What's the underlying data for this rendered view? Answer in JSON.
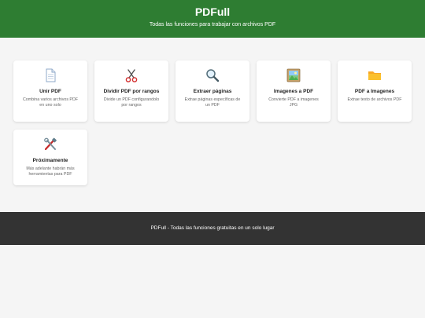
{
  "header": {
    "title": "PDFull",
    "subtitle": "Todas las funciones para trabajar con archivos PDF"
  },
  "tools": [
    {
      "icon": "document-icon",
      "title": "Unir PDF",
      "desc": "Combina varios archivos PDF en uno solo"
    },
    {
      "icon": "scissors-icon",
      "title": "Dividir PDF por rangos",
      "desc": "Divide un PDF configurandolo por rangos"
    },
    {
      "icon": "magnifier-icon",
      "title": "Extraer páginas",
      "desc": "Extrae páginas específicas de un PDF"
    },
    {
      "icon": "picture-icon",
      "title": "Imagenes a PDF",
      "desc": "Convierte PDF a imagenes JPG"
    },
    {
      "icon": "folder-icon",
      "title": "PDF a Imagenes",
      "desc": "Extrae texto de archivos PDF"
    },
    {
      "icon": "tools-icon",
      "title": "Próximamente",
      "desc": "Más adelante habrán más herramientas para PDF"
    }
  ],
  "footer": {
    "text": "PDFull - Todas las funciones gratuitas en un solo lugar"
  },
  "colors": {
    "header_bg": "#2e7d32",
    "footer_bg": "#333333",
    "page_bg": "#f5f5f5"
  }
}
